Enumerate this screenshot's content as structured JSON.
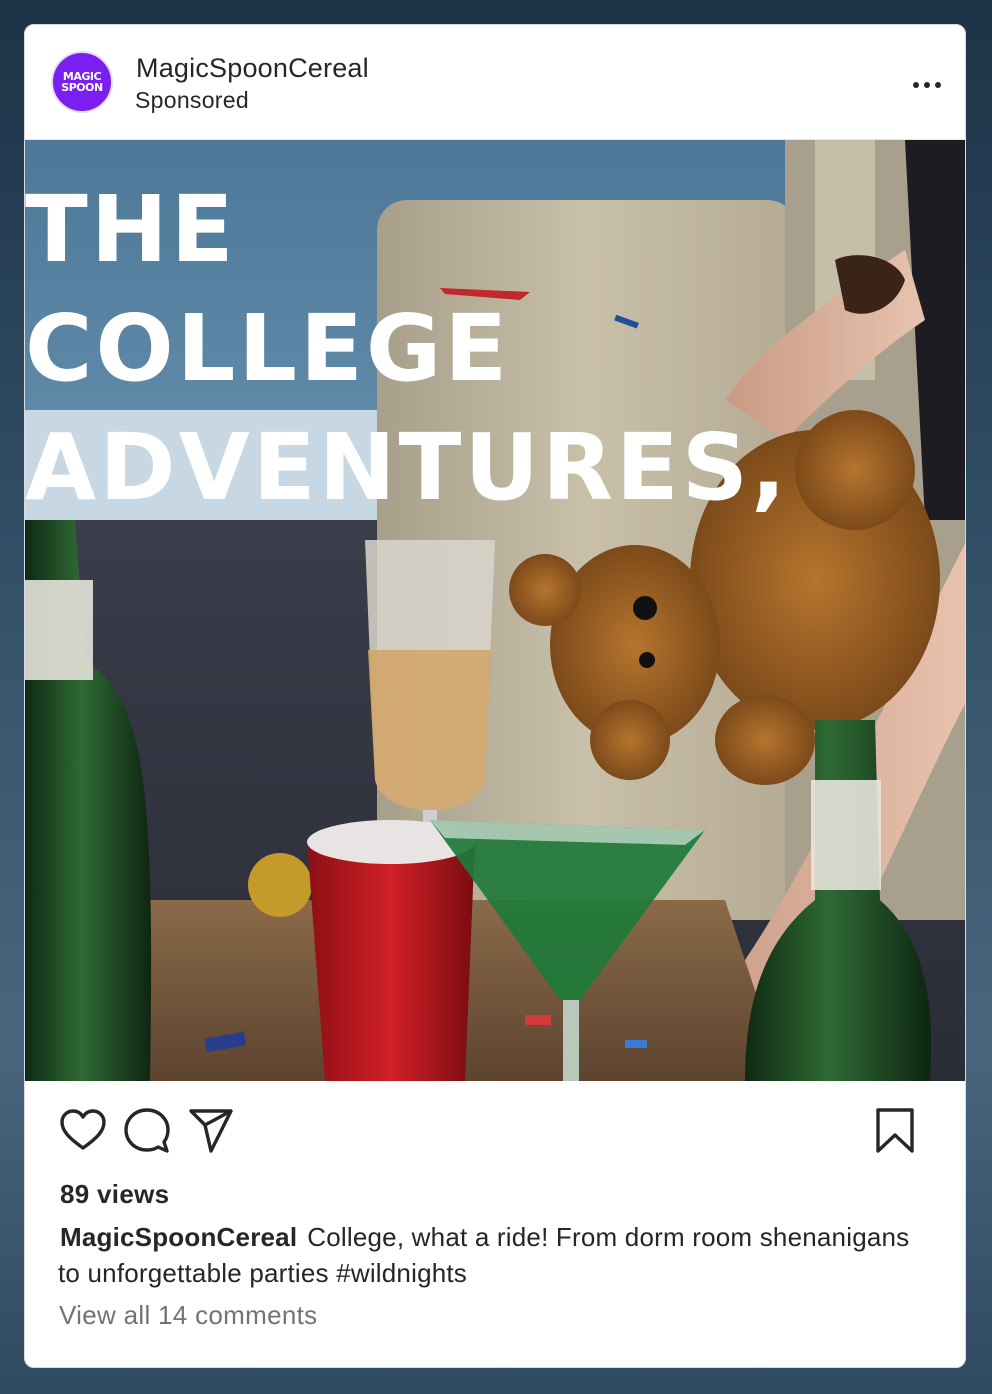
{
  "post": {
    "account_name": "MagicSpoonCereal",
    "sponsored_label": "Sponsored",
    "avatar": {
      "line1": "MAGIC",
      "line2": "SPOON",
      "color": "#7a1ff0"
    },
    "more_icon": "more-horizontal-icon"
  },
  "media": {
    "headline_lines": [
      "THE",
      "COLLEGE",
      "ADVENTURES,"
    ],
    "description_icon": "party-photo"
  },
  "actions": {
    "like_icon": "heart-icon",
    "comment_icon": "comment-icon",
    "share_icon": "send-icon",
    "save_icon": "bookmark-icon"
  },
  "stats": {
    "views": "89 views"
  },
  "caption": {
    "username": "MagicSpoonCereal",
    "text": "College, what a ride! From dorm room shenanigans to unforgettable parties #wildnights"
  },
  "comments": {
    "view_all_label": "View all 14 comments"
  },
  "colors": {
    "brand": "#7a1ff0",
    "text": "#262626",
    "muted": "#737373"
  }
}
